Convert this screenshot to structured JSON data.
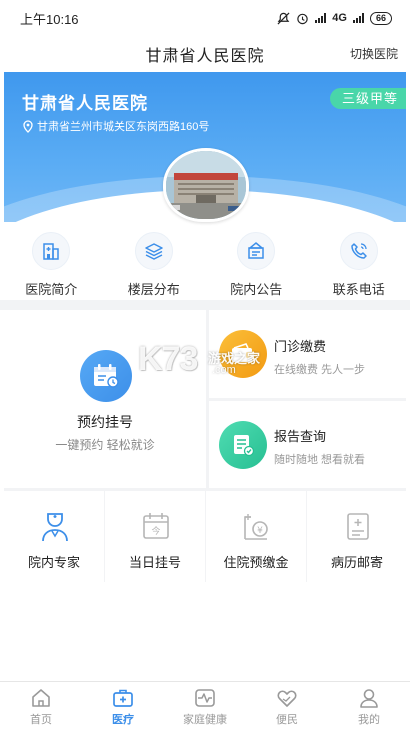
{
  "status_bar": {
    "time": "上午10:16",
    "network": "4G",
    "battery": "66"
  },
  "header": {
    "title": "甘肃省人民医院",
    "switch_label": "切换医院"
  },
  "banner": {
    "hospital_name": "甘肃省人民医院",
    "address": "甘肃省兰州市城关区东岗西路160号",
    "level_badge": "三级甲等"
  },
  "quick_entries": [
    {
      "label": "医院简介",
      "icon": "hospital-building-icon"
    },
    {
      "label": "楼层分布",
      "icon": "layers-icon"
    },
    {
      "label": "院内公告",
      "icon": "notice-board-icon"
    },
    {
      "label": "联系电话",
      "icon": "phone-icon"
    }
  ],
  "services": {
    "appointment": {
      "title": "预约挂号",
      "subtitle": "一键预约 轻松就诊"
    },
    "payment": {
      "title": "门诊缴费",
      "subtitle": "在线缴费 先人一步"
    },
    "report": {
      "title": "报告查询",
      "subtitle": "随时随地 想看就看"
    }
  },
  "small_services": [
    {
      "label": "院内专家",
      "icon": "doctor-icon"
    },
    {
      "label": "当日挂号",
      "icon": "calendar-today-icon"
    },
    {
      "label": "住院预缴金",
      "icon": "inpatient-deposit-icon"
    },
    {
      "label": "病历邮寄",
      "icon": "medical-record-mail-icon"
    }
  ],
  "watermark": {
    "logo": "K73",
    "site": "游戏之家",
    "domain": ".com"
  },
  "tabs": [
    {
      "label": "首页",
      "icon": "home-icon",
      "active": false
    },
    {
      "label": "医疗",
      "icon": "medical-kit-icon",
      "active": true
    },
    {
      "label": "家庭健康",
      "icon": "heartbeat-icon",
      "active": false
    },
    {
      "label": "便民",
      "icon": "heart-hand-icon",
      "active": false
    },
    {
      "label": "我的",
      "icon": "user-icon",
      "active": false
    }
  ],
  "colors": {
    "primary": "#3d8fe9",
    "banner_top": "#3f98ee",
    "level_badge": "#49d6a9",
    "payment_icon": "#f5ab1d",
    "report_icon": "#36cfa1",
    "inactive": "#999999"
  }
}
